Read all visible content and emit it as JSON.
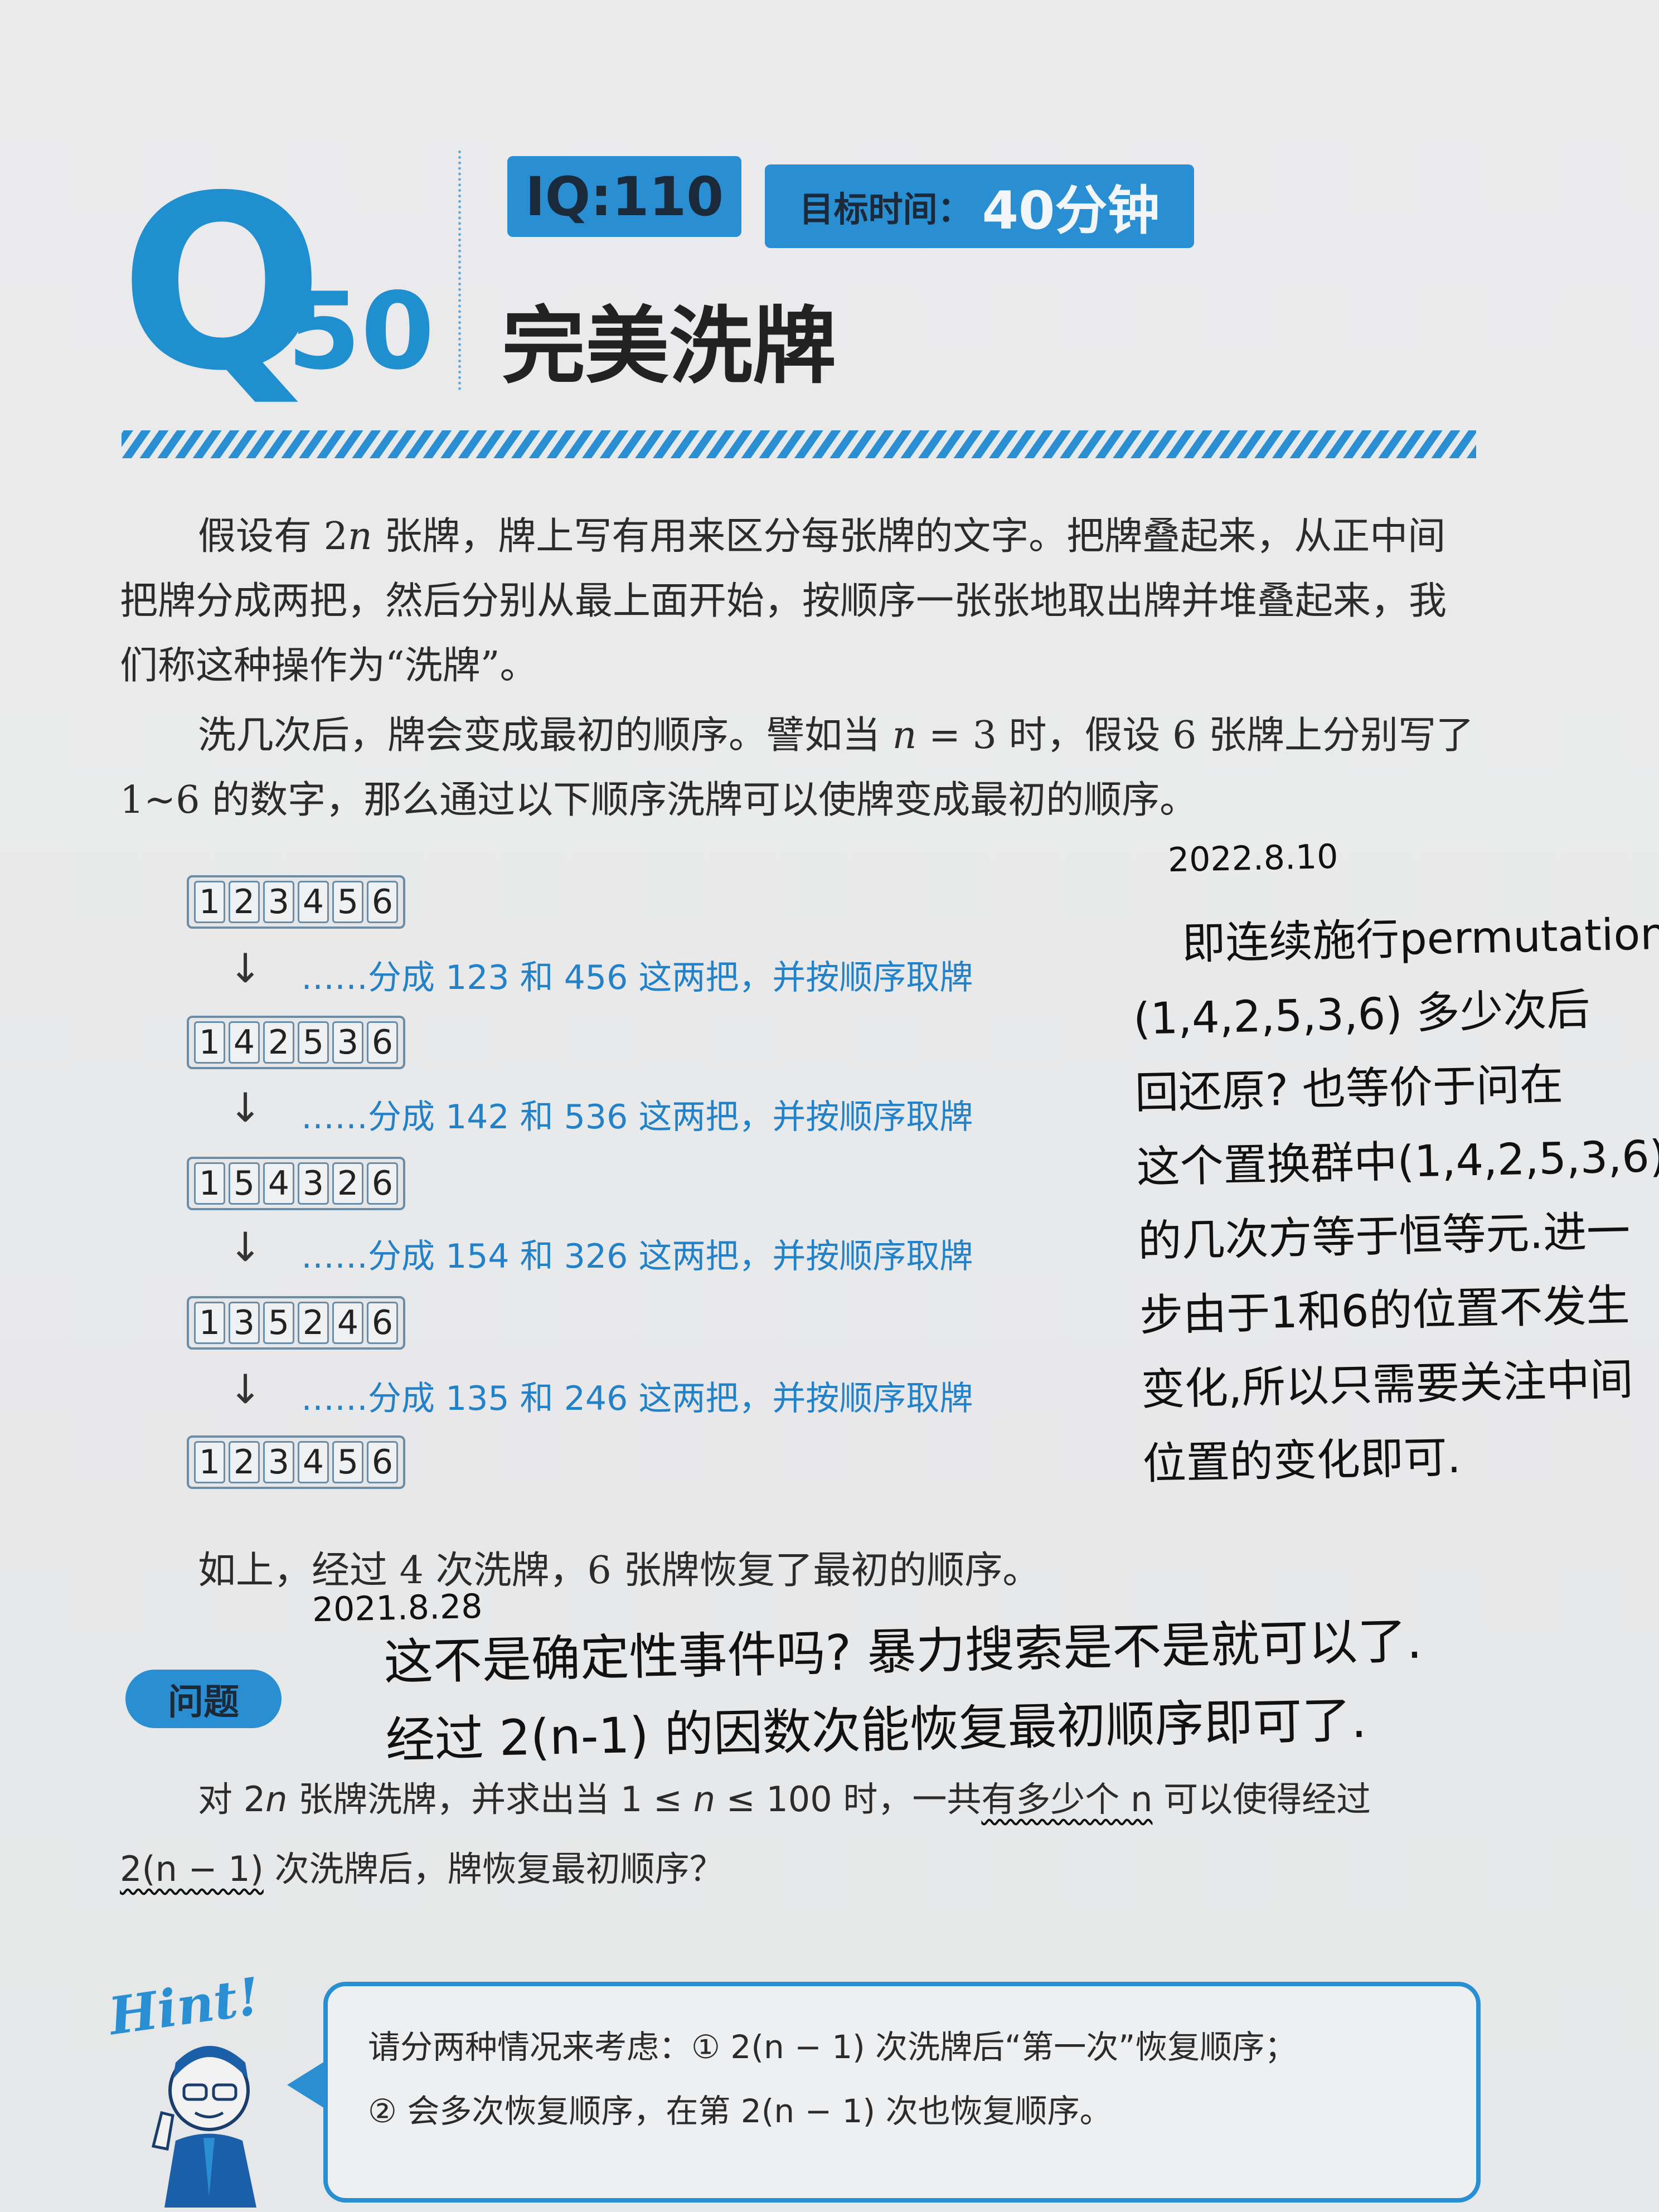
{
  "header": {
    "q_letter": "Q",
    "q_number": "50",
    "iq": "IQ:110",
    "time_label": "目标时间：",
    "time_value": "40分钟",
    "title": "完美洗牌"
  },
  "intro": {
    "p1_a": "假设有 2",
    "p1_n": "n",
    "p1_b": " 张牌，牌上写有用来区分每张牌的文字。把牌叠起来，从正中间把牌分成两把，然后分别从最上面开始，按顺序一张张地取出牌并堆叠起来，我们称这种操作为“洗牌”。",
    "p2_a": "洗几次后，牌会变成最初的顺序。譬如当 ",
    "p2_n": "n",
    "p2_b": " = 3 时，假设 6 张牌上分别写了 1~6 的数字，那么通过以下顺序洗牌可以使牌变成最初的顺序。"
  },
  "sequence": {
    "rows": [
      [
        "1",
        "2",
        "3",
        "4",
        "5",
        "6"
      ],
      [
        "1",
        "4",
        "2",
        "5",
        "3",
        "6"
      ],
      [
        "1",
        "5",
        "4",
        "3",
        "2",
        "6"
      ],
      [
        "1",
        "3",
        "5",
        "2",
        "4",
        "6"
      ],
      [
        "1",
        "2",
        "3",
        "4",
        "5",
        "6"
      ]
    ],
    "arrow": "↓",
    "notes": [
      "……分成 123 和 456 这两把，并按顺序取牌",
      "……分成 142 和 536 这两把，并按顺序取牌",
      "……分成 154 和 326 这两把，并按顺序取牌",
      "……分成 135 和 246 这两把，并按顺序取牌"
    ]
  },
  "conclusion": "如上，经过 4 次洗牌，6 张牌恢复了最初的顺序。",
  "handwriting_right": {
    "date": "2022.8.10",
    "lines": [
      "即连续施行permutation",
      "(1,4,2,5,3,6) 多少次后",
      "回还原? 也等价于问在",
      "这个置换群中(1,4,2,5,3,6)",
      "的几次方等于恒等元.进一",
      "步由于1和6的位置不发生",
      "变化,所以只需要关注中间",
      "位置的变化即可."
    ]
  },
  "handwriting_mid": {
    "date": "2021.8.28",
    "lines": [
      "这不是确定性事件吗? 暴力搜索是不是就可以了.",
      "经过 2(n-1) 的因数次能恢复最初顺序即可了."
    ]
  },
  "question": {
    "tag": "问题",
    "line1_a": "对 2",
    "line1_n": "n",
    "line1_b": " 张牌洗牌，并求出当 1 ≤ ",
    "line1_n2": "n",
    "line1_c": " ≤ 100 时，一共",
    "line1_wavy": "有多少个 n",
    "line1_d": " 可以使得经过",
    "line2_wavy": "2(n − 1)",
    "line2_b": " 次洗牌后，牌恢复最初顺序？"
  },
  "hint": {
    "word": "Hint!",
    "line1": "请分两种情况来考虑：① 2(n − 1) 次洗牌后“第一次”恢复顺序；",
    "line2": "② 会多次恢复顺序，在第 2(n − 1) 次也恢复顺序。"
  },
  "colors": {
    "accent": "#2a8fd2",
    "step_note": "#2381c8",
    "paper": "#e9eaeb"
  }
}
